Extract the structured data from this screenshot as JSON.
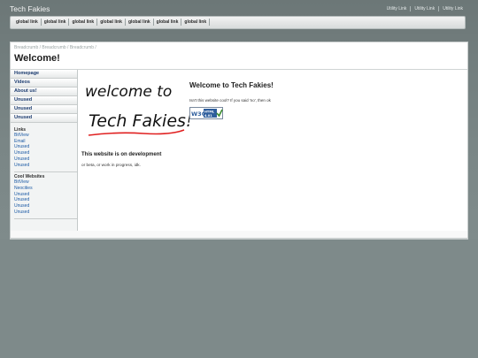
{
  "header": {
    "site_title": "Tech Fakies",
    "utility_links": [
      "Utility Link",
      "Utility Link",
      "Utility Link"
    ]
  },
  "global_nav": [
    "global link",
    "global link",
    "global link",
    "global link",
    "global link",
    "global link",
    "global link"
  ],
  "breadcrumb": [
    "Breadcrumb",
    "Breadcrumb",
    "Breadcrumb"
  ],
  "page_title": "Welcome!",
  "sidebar": {
    "nav_items": [
      "Homepage",
      "Videos",
      "About us!",
      "Unused",
      "Unused",
      "Unused"
    ],
    "links_heading": "Links",
    "links": [
      "BitView",
      "Email",
      "Unused",
      "Unused",
      "Unused",
      "Unused"
    ],
    "cool_heading": "Cool Websites",
    "cool_links": [
      "BitView",
      "Neocities",
      "Unused",
      "Unused",
      "Unused",
      "Unused"
    ]
  },
  "content": {
    "welcome_heading": "Welcome to Tech Fakies!",
    "welcome_text": "Isn't this website cool? If you said 'no', then ok",
    "dev_heading": "This website is on development",
    "dev_text": "or beta, or work in progress, idk.",
    "badge": {
      "w3c": "W3C",
      "html": "HTML",
      "version": "4.01"
    },
    "handwriting": {
      "line1": "welcome to",
      "line2": "Tech Fakies!"
    }
  },
  "colors": {
    "background": "#7e8a8a",
    "link": "#1c5aa5",
    "nav_text": "#1a3a6e",
    "underline": "#e02020"
  }
}
